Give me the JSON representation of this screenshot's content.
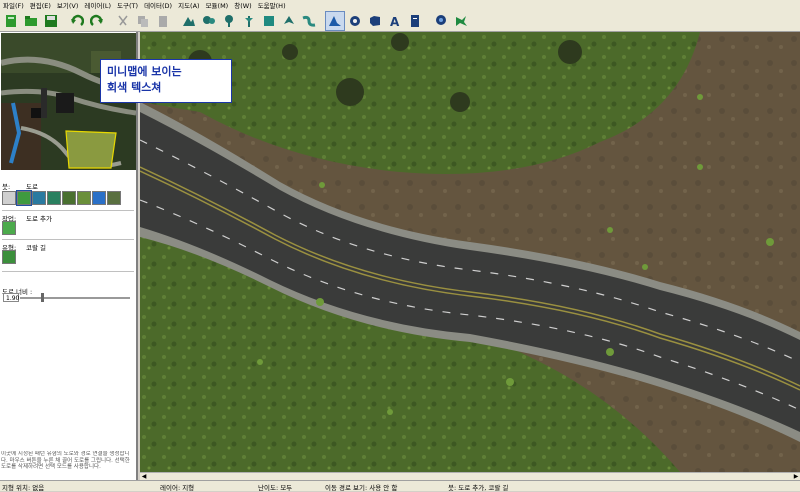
{
  "menu": [
    "파일(F)",
    "편집(E)",
    "보기(V)",
    "레이어(L)",
    "도구(T)",
    "데이터(D)",
    "지도(A)",
    "모듈(M)",
    "창(W)",
    "도움말(H)"
  ],
  "toolbar": {
    "icons": [
      "new-file-icon",
      "open-folder-icon",
      "save-icon",
      "undo-icon",
      "redo-icon",
      "cut-icon",
      "copy-icon",
      "paste-icon",
      "terrain-icon",
      "trees-icon",
      "tree-icon",
      "doodad-icon",
      "tile-icon",
      "unit-icon",
      "path-icon",
      "road-icon",
      "cliff-icon",
      "region-icon",
      "text-icon",
      "document-icon",
      "tree-brush-icon",
      "dragon-icon"
    ]
  },
  "callout": {
    "line1": "미니맵에 보이는",
    "line2": "회색 텍스쳐"
  },
  "panel": {
    "brush_label": "붓:",
    "brush_value": "도로",
    "action_label": "작업:",
    "action_value": "도로 추가",
    "type_label": "유형:",
    "type_value": "코랄 길",
    "width_label": "도로 너비 :",
    "width_value": "1.90",
    "width_fraction": 0.2
  },
  "help_text": "이곳에 지정된 패턴 유형의 도로와 경로 연결을 생성합니다. 마우스 버튼을 누른 채 끌어 도로를 그립니다. 선택한 도로를 삭제하려면 선택 모드를 사용합니다.",
  "status": {
    "zoom": "지형 위치: 없음",
    "layer": "레이어: 지형",
    "difficulty": "난이도: 모두",
    "path_view": "이동 경로 보기: 사용 안 함",
    "brush": "붓: 도로 추가, 코랄 길"
  },
  "colors": {
    "callout_border": "#1a35a8",
    "road": "#3a3b3a",
    "grass": "#4f6b2c",
    "dirt": "#6a5c47"
  }
}
